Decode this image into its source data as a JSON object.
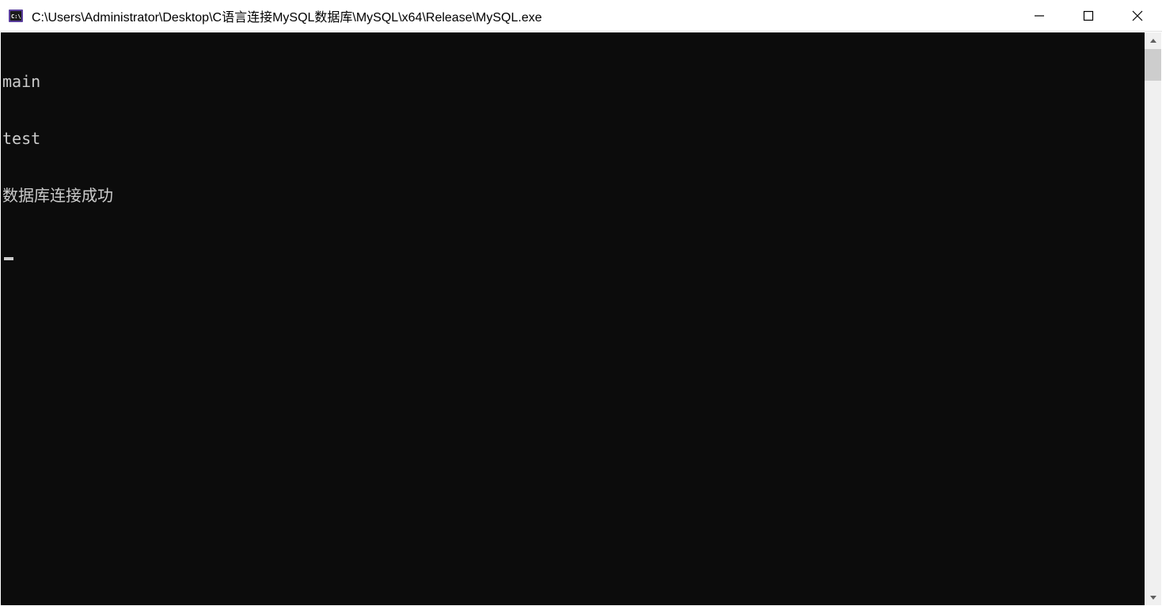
{
  "window": {
    "title": "C:\\Users\\Administrator\\Desktop\\C语言连接MySQL数据库\\MySQL\\x64\\Release\\MySQL.exe"
  },
  "console": {
    "lines": [
      "main",
      "test",
      "数据库连接成功"
    ]
  }
}
